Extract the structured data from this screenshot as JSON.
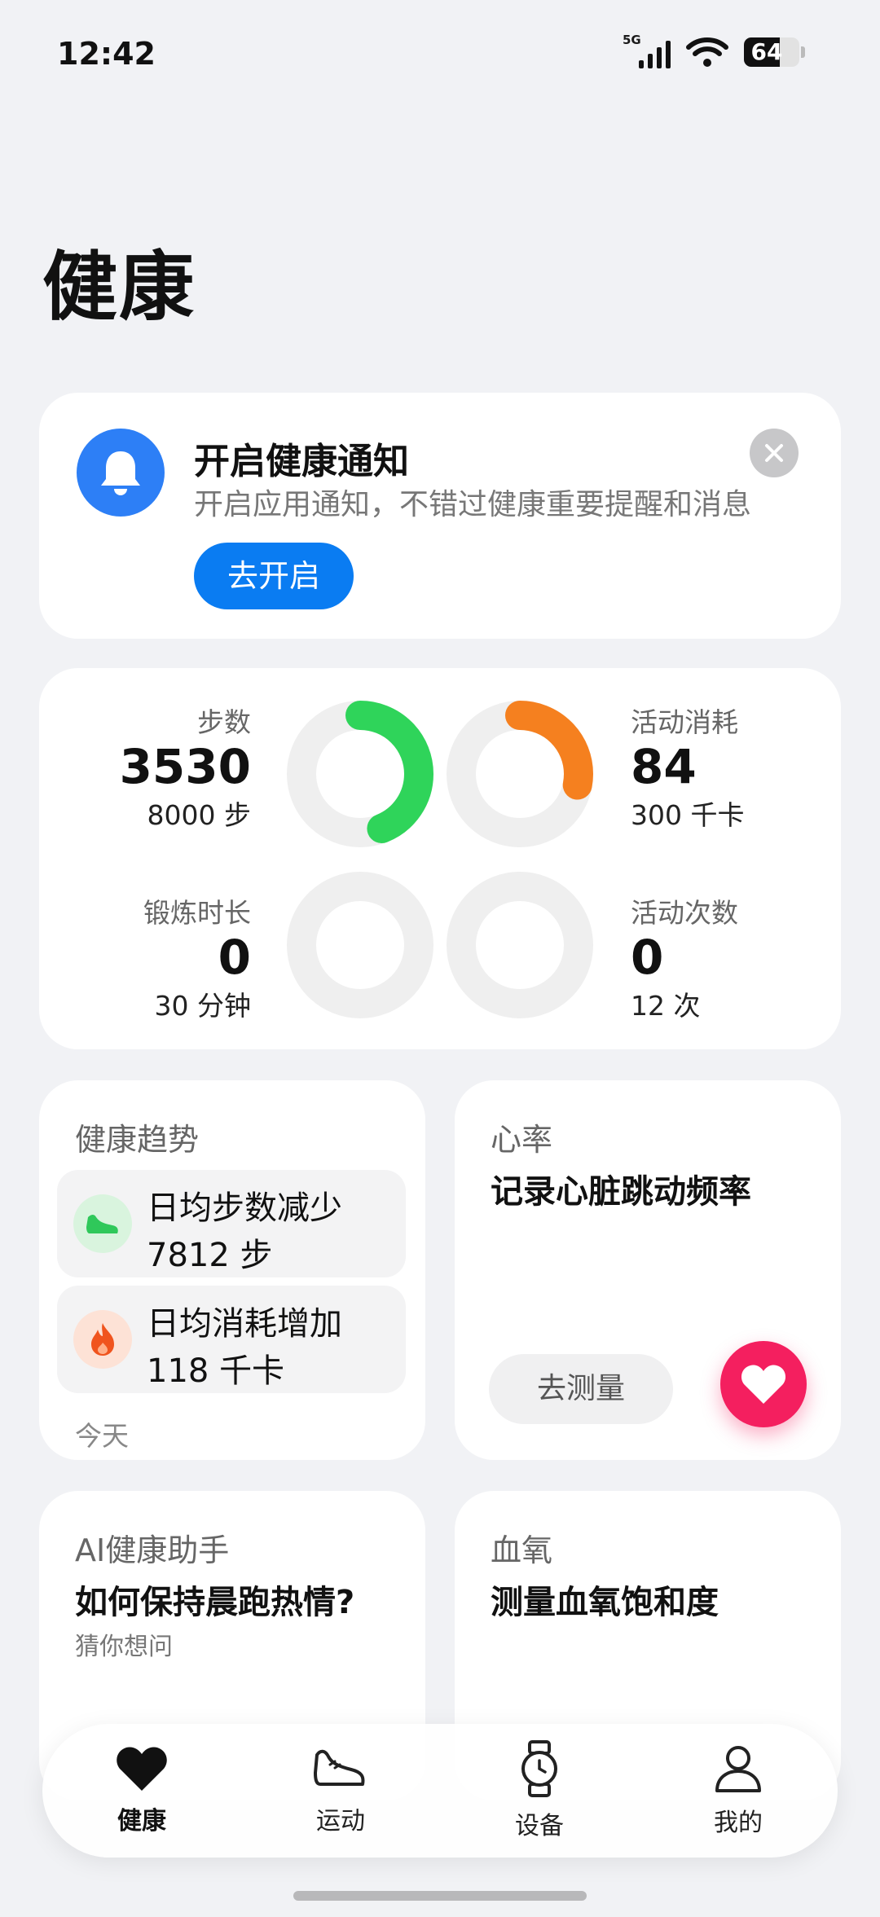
{
  "status_bar": {
    "time": "12:42",
    "network": "5G",
    "battery": "64",
    "battery_level": 0.64
  },
  "page": {
    "title": "健康"
  },
  "notification": {
    "title": "开启健康通知",
    "description": "开启应用通知，不错过健康重要提醒和消息",
    "button": "去开启"
  },
  "activity": {
    "steps": {
      "label": "步数",
      "value": "3530",
      "goal": "8000 步",
      "progress": 0.44,
      "color": "#2fd45a"
    },
    "calories": {
      "label": "活动消耗",
      "value": "84",
      "goal": "300 千卡",
      "progress": 0.28,
      "color": "#f5801f"
    },
    "exercise": {
      "label": "锻炼时长",
      "value": "0",
      "goal": "30 分钟",
      "progress": 0,
      "color": "#2d9cf0"
    },
    "activities": {
      "label": "活动次数",
      "value": "0",
      "goal": "12 次",
      "progress": 0,
      "color": "#f5c518"
    }
  },
  "trend": {
    "title": "健康趋势",
    "items": [
      {
        "line1": "日均步数减少",
        "line2": "7812 步",
        "icon": "shoe-icon",
        "color": "#2fc85a"
      },
      {
        "line1": "日均消耗增加",
        "line2": "118 千卡",
        "icon": "flame-icon",
        "color": "#f0541e"
      }
    ],
    "footer": "今天"
  },
  "heart_rate": {
    "title": "心率",
    "headline": "记录心脏跳动频率",
    "button": "去测量",
    "color": "#f41f5f"
  },
  "ai_assistant": {
    "title": "AI健康助手",
    "headline": "如何保持晨跑热情?",
    "sub": "猜你想问"
  },
  "blood_oxygen": {
    "title": "血氧",
    "headline": "测量血氧饱和度"
  },
  "nav": {
    "tabs": [
      {
        "label": "健康",
        "icon": "heart-icon",
        "active": true
      },
      {
        "label": "运动",
        "icon": "shoe-icon",
        "active": false
      },
      {
        "label": "设备",
        "icon": "watch-icon",
        "active": false
      },
      {
        "label": "我的",
        "icon": "person-icon",
        "active": false
      }
    ]
  }
}
